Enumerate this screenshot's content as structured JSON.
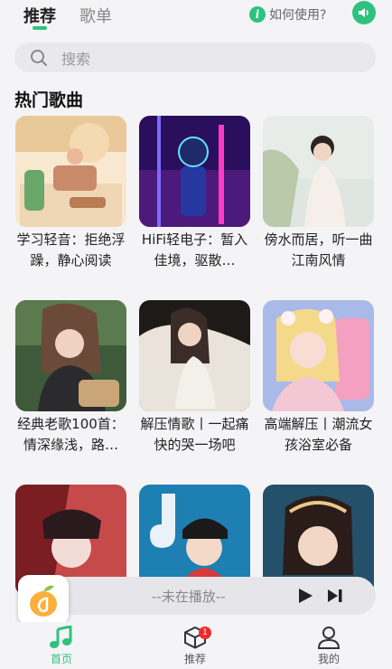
{
  "tabs": {
    "active": "推荐",
    "inactive": "歌单"
  },
  "help": {
    "icon": "info-icon",
    "text": "如何使用?"
  },
  "search": {
    "placeholder": "搜索"
  },
  "section": {
    "title": "热门歌曲"
  },
  "songs": [
    {
      "title": "学习轻音：拒绝浮躁，静心阅读"
    },
    {
      "title": "HiFi轻电子：暂入佳境，驱散…"
    },
    {
      "title": "傍水而居，听一曲江南风情"
    },
    {
      "title": "经典老歌100首：情深缘浅，路…"
    },
    {
      "title": "解压情歌丨一起痛快的哭一场吧"
    },
    {
      "title": "高端解压丨潮流女孩浴室必备"
    },
    {
      "title": ""
    },
    {
      "title": ""
    },
    {
      "title": ""
    }
  ],
  "player": {
    "status": "--未在播放--"
  },
  "nav": {
    "home": "首页",
    "recommend": "推荐",
    "recommend_badge": "1",
    "mine": "我的"
  },
  "colors": {
    "accent": "#2ec27e",
    "badge": "#f02b2b"
  }
}
